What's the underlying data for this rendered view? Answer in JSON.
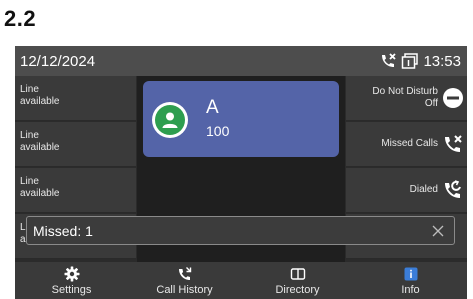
{
  "section_heading": "2.2",
  "status_bar": {
    "date": "12/12/2024",
    "time": "13:53",
    "icons": [
      "missed-call-icon",
      "dnd-status-icon"
    ]
  },
  "line_keys": [
    {
      "line1": "Line",
      "line2": "available"
    },
    {
      "line1": "Line",
      "line2": "available"
    },
    {
      "line1": "Line",
      "line2": "available"
    },
    {
      "line1": "L",
      "line2": "a"
    }
  ],
  "account": {
    "name": "A",
    "number": "100",
    "avatar_color": "#2e9e4f",
    "card_color": "#5464a8"
  },
  "function_keys": [
    {
      "line1": "Do Not Disturb",
      "line2": "Off",
      "icon": "dnd-icon"
    },
    {
      "line1": "Missed Calls",
      "line2": "",
      "icon": "missed-call-icon"
    },
    {
      "line1": "Dialed",
      "line2": "",
      "icon": "dialed-call-icon"
    }
  ],
  "notification": {
    "text": "Missed: 1",
    "close_icon": "close-icon"
  },
  "softkeys": [
    {
      "label": "Settings",
      "icon": "gear-icon"
    },
    {
      "label": "Call History",
      "icon": "call-history-icon"
    },
    {
      "label": "Directory",
      "icon": "book-icon"
    },
    {
      "label": "Info",
      "icon": "info-icon"
    }
  ],
  "colors": {
    "info_icon": "#3b7dd8",
    "background": "#2b2b2b",
    "status_bar": "#4d4d4d"
  }
}
